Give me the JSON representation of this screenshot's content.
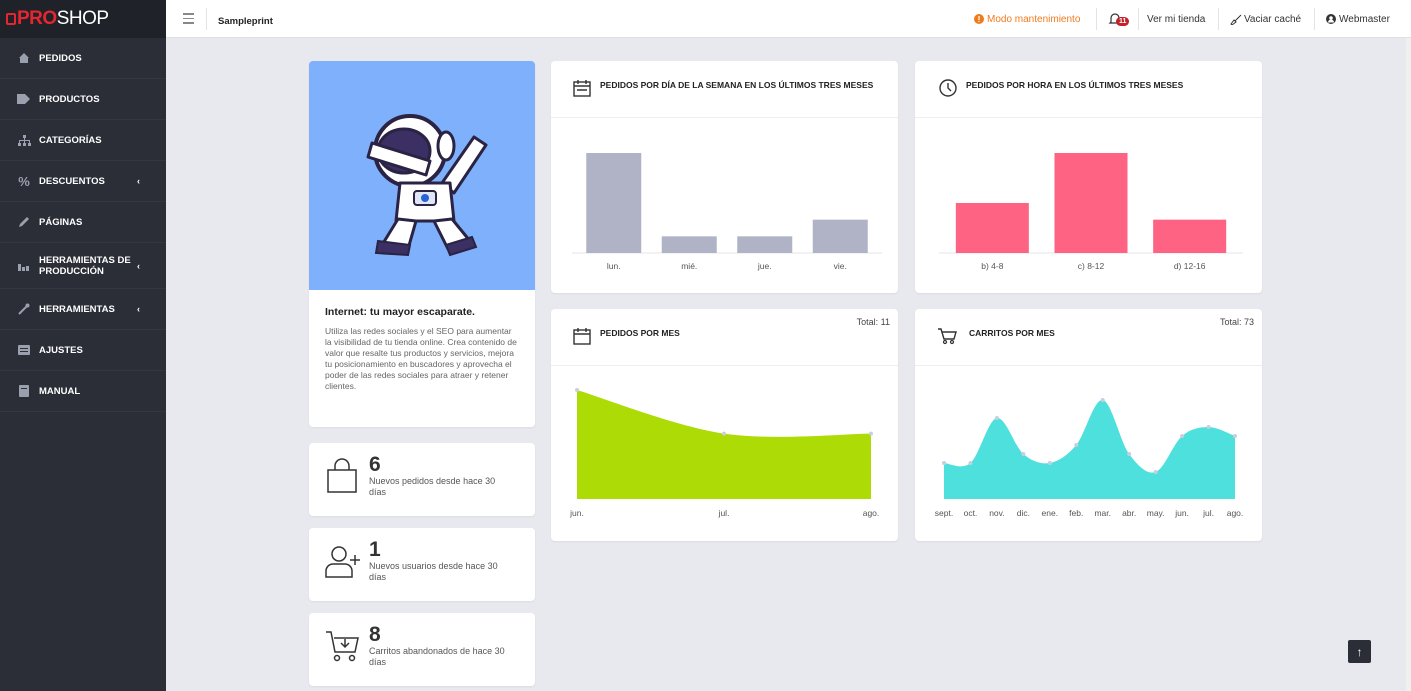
{
  "app": {
    "logo_pro": "PRO",
    "logo_shop": "SHOP"
  },
  "sidebar": {
    "items": [
      {
        "label": "PEDIDOS",
        "icon": "home-icon"
      },
      {
        "label": "PRODUCTOS",
        "icon": "tag-icon"
      },
      {
        "label": "CATEGORÍAS",
        "icon": "sitemap-icon"
      },
      {
        "label": "DESCUENTOS",
        "icon": "percent-icon",
        "submenu": true
      },
      {
        "label": "PÁGINAS",
        "icon": "pencil-icon"
      },
      {
        "label": "HERRAMIENTAS DE PRODUCCIÓN",
        "icon": "chart-bar-icon",
        "submenu": true
      },
      {
        "label": "HERRAMIENTAS",
        "icon": "wrench-icon",
        "submenu": true
      },
      {
        "label": "AJUSTES",
        "icon": "sliders-icon"
      },
      {
        "label": "MANUAL",
        "icon": "book-icon"
      }
    ]
  },
  "topbar": {
    "store_name": "Sampleprint",
    "maintenance": "Modo mantenimiento",
    "notifications_count": "11",
    "view_store": "Ver mi tienda",
    "clear_cache": "Vaciar caché",
    "user": "Webmaster"
  },
  "hero": {
    "title": "Internet: tu mayor escaparate.",
    "text": "Utiliza las redes sociales y el SEO para aumentar la visibilidad de tu tienda online. Crea contenido de valor que resalte tus productos y servicios, mejora tu posicionamiento en buscadores y aprovecha el poder de las redes sociales para atraer y retener clientes."
  },
  "stats": [
    {
      "value": "6",
      "label": "Nuevos pedidos desde hace 30 días",
      "icon": "shopping-bag-icon"
    },
    {
      "value": "1",
      "label": "Nuevos usuarios desde hace 30 días",
      "icon": "user-plus-icon"
    },
    {
      "value": "8",
      "label": "Carritos abandonados de hace 30 días",
      "icon": "cart-download-icon"
    }
  ],
  "charts": {
    "weekday": {
      "title": "PEDIDOS POR DÍA DE LA SEMANA EN LOS ÚLTIMOS TRES MESES"
    },
    "hour": {
      "title": "PEDIDOS POR HORA EN LOS ÚLTIMOS TRES MESES"
    },
    "month_orders": {
      "title": "PEDIDOS POR MES",
      "total": "Total: 11"
    },
    "month_carts": {
      "title": "CARRITOS POR MES",
      "total": "Total: 73"
    }
  },
  "chart_data": [
    {
      "type": "bar",
      "title": "PEDIDOS POR DÍA DE LA SEMANA EN LOS ÚLTIMOS TRES MESES",
      "categories": [
        "lun.",
        "mié.",
        "jue.",
        "vie."
      ],
      "values": [
        6,
        1,
        1,
        2
      ],
      "color": "#b0b3c6"
    },
    {
      "type": "bar",
      "title": "PEDIDOS POR HORA EN LOS ÚLTIMOS TRES MESES",
      "categories": [
        "b) 4-8",
        "c) 8-12",
        "d) 12-16"
      ],
      "values": [
        3,
        6,
        2
      ],
      "color": "#ff6384"
    },
    {
      "type": "area",
      "title": "PEDIDOS POR MES",
      "categories": [
        "jun.",
        "jul.",
        "ago."
      ],
      "values": [
        5,
        3,
        3
      ],
      "color": "#acdb06"
    },
    {
      "type": "area",
      "title": "CARRITOS POR MES",
      "categories": [
        "sept.",
        "oct.",
        "nov.",
        "dic.",
        "ene.",
        "feb.",
        "mar.",
        "abr.",
        "may.",
        "jun.",
        "jul.",
        "ago."
      ],
      "values": [
        4,
        4,
        9,
        5,
        4,
        6,
        11,
        5,
        3,
        7,
        8,
        7
      ],
      "color": "#4de0dc"
    }
  ]
}
